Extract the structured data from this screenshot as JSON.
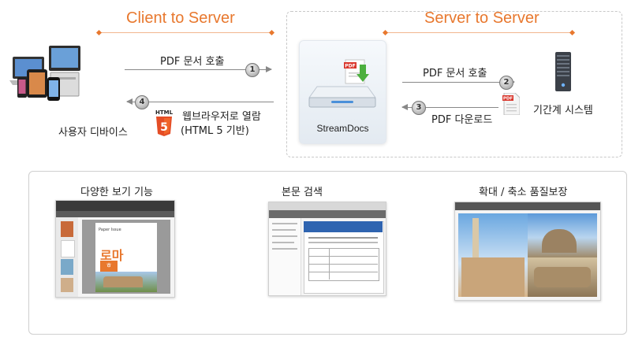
{
  "sections": {
    "client_to_server": "Client to Server",
    "server_to_server": "Server to Server"
  },
  "flow": {
    "step1_label": "PDF 문서 호출",
    "step1_num": "1",
    "step4_label_line1": "웹브라우저로 열람",
    "step4_label_line2": "(HTML 5 기반)",
    "step4_num": "4",
    "step2_label": "PDF 문서 호출",
    "step2_num": "2",
    "step3_label": "PDF 다운로드",
    "step3_num": "3"
  },
  "nodes": {
    "user_devices": "사용자 디바이스",
    "streamdocs": "StreamDocs",
    "core_system": "기간계 시스템",
    "pdf_badge": "PDF",
    "html5_badge": "HTML"
  },
  "features": [
    {
      "title": "다양한 보기 기능",
      "thumb_heading": "Paper Issue",
      "thumb_big": "로마",
      "thumb_small": "ㅎ"
    },
    {
      "title": "본문 검색"
    },
    {
      "title": "확대 / 축소 품질보장"
    }
  ],
  "colors": {
    "accent_orange": "#e8782e",
    "line_orange": "#f2b58e",
    "arrow_grey": "#888888",
    "html5_orange": "#e44d26",
    "pdf_red": "#d9352b",
    "green": "#4caf3e"
  }
}
